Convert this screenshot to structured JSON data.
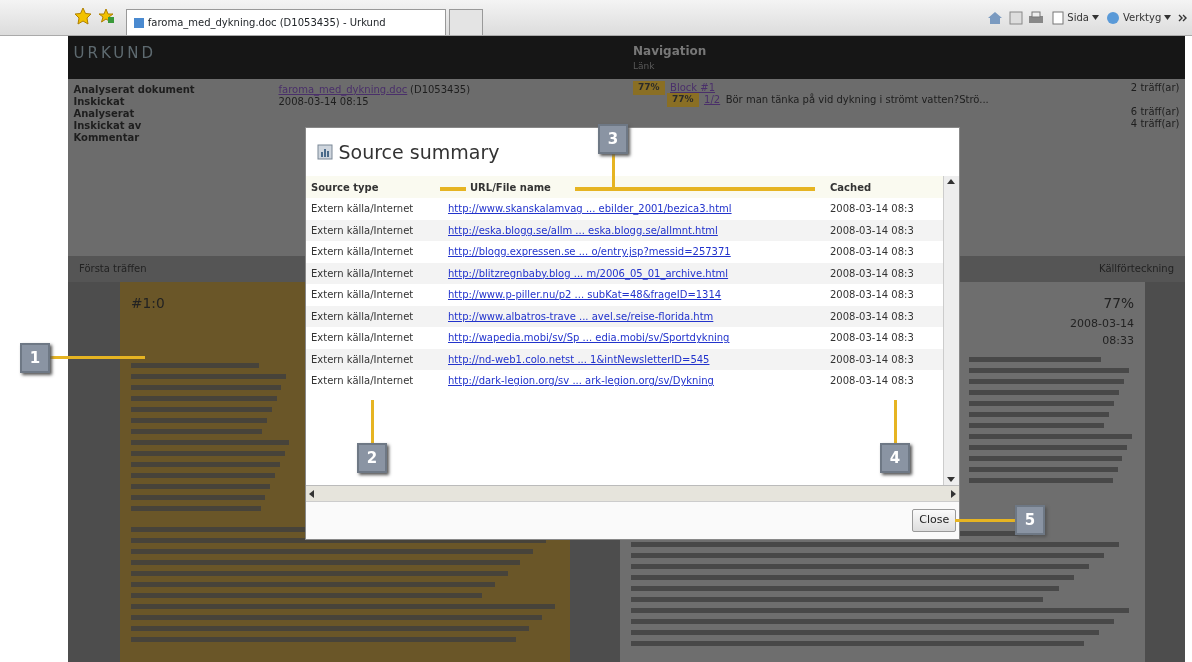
{
  "browser": {
    "tab_title": "faroma_med_dykning.doc (D1053435) - Urkund",
    "toolbar": [
      {
        "label": "Sida"
      },
      {
        "label": "Verktyg"
      }
    ]
  },
  "app": {
    "logo": "URKUND",
    "navigation": {
      "title": "Navigation",
      "subtitle": "Länk"
    },
    "info": [
      {
        "label": "Analyserat dokument",
        "value": "faroma_med_dykning.doc",
        "extra": "(D1053435)",
        "kind": "link"
      },
      {
        "label": "Inskickat",
        "value": "2008-03-14 08:15",
        "kind": "text"
      },
      {
        "label": "Analyserat",
        "kind": "text"
      },
      {
        "label": "Inskickat av",
        "kind": "text"
      },
      {
        "label": "Kommentar",
        "kind": "text"
      }
    ],
    "nav_rows": [
      {
        "percent": "77%",
        "link": "Block #1",
        "hits": "2 träff(ar)",
        "children": [
          {
            "percent": "77%",
            "link": "1/2",
            "text": "Bör man tänka på vid dykning i strömt vatten?Strö..."
          }
        ]
      },
      {
        "hits": "6 träff(ar)"
      },
      {
        "hits": "4 träff(ar)"
      }
    ],
    "left_pane": {
      "toolbar": "Första träffen",
      "heading": "#1:0"
    },
    "right_pane": {
      "toolbar": "Källförteckning",
      "percent": "77%",
      "date": "2008-03-14",
      "time": "08:33"
    }
  },
  "dialog": {
    "title": "Source summary",
    "columns": [
      "Source type",
      "URL/File name",
      "Cached"
    ],
    "rows": [
      {
        "type": "Extern källa/Internet",
        "url": "http://www.skanskalamvag ... ebilder_2001/bezica3.html",
        "cached": "2008-03-14 08:3"
      },
      {
        "type": "Extern källa/Internet",
        "url": "http://eska.blogg.se/allm ... eska.blogg.se/allmnt.html",
        "cached": "2008-03-14 08:3"
      },
      {
        "type": "Extern källa/Internet",
        "url": "http://blogg.expressen.se ... o/entry.jsp?messid=257371",
        "cached": "2008-03-14 08:3"
      },
      {
        "type": "Extern källa/Internet",
        "url": "http://blitzregnbaby.blog ... m/2006_05_01_archive.html",
        "cached": "2008-03-14 08:3"
      },
      {
        "type": "Extern källa/Internet",
        "url": "http://www.p-piller.nu/p2 ... subKat=48&frageID=1314",
        "cached": "2008-03-14 08:3"
      },
      {
        "type": "Extern källa/Internet",
        "url": "http://www.albatros-trave ... avel.se/reise-florida.htm",
        "cached": "2008-03-14 08:3"
      },
      {
        "type": "Extern källa/Internet",
        "url": "http://wapedia.mobi/sv/Sp ... edia.mobi/sv/Sportdykning",
        "cached": "2008-03-14 08:3"
      },
      {
        "type": "Extern källa/Internet",
        "url": "http://nd-web1.colo.netst ... 1&intNewsletterID=545",
        "cached": "2008-03-14 08:3"
      },
      {
        "type": "Extern källa/Internet",
        "url": "http://dark-legion.org/sv ... ark-legion.org/sv/Dykning",
        "cached": "2008-03-14 08:3"
      }
    ],
    "close": "Close"
  },
  "callouts": [
    "1",
    "2",
    "3",
    "4",
    "5"
  ]
}
